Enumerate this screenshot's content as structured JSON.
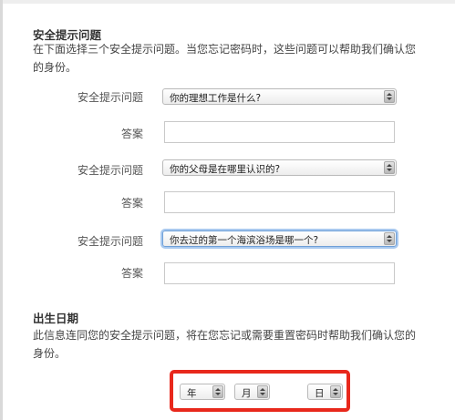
{
  "security": {
    "title": "安全提示问题",
    "description": "在下面选择三个安全提示问题。当您忘记密码时，这些问题可以帮助我们确认您的身份。",
    "questions": [
      {
        "label": "安全提示问题",
        "value": "你的理想工作是什么?",
        "answer_label": "答案",
        "answer": ""
      },
      {
        "label": "安全提示问题",
        "value": "你的父母是在哪里认识的?",
        "answer_label": "答案",
        "answer": ""
      },
      {
        "label": "安全提示问题",
        "value": "你去过的第一个海滨浴场是哪一个?",
        "answer_label": "答案",
        "answer": ""
      }
    ]
  },
  "birthdate": {
    "title": "出生日期",
    "description": "此信息连同您的安全提示问题，将在您忘记或需要重置密码时帮助我们确认您的身份。",
    "year": "年",
    "month": "月",
    "day": "日"
  },
  "colors": {
    "highlight": "#e8281c",
    "focus_ring": "#a9c9ef"
  }
}
